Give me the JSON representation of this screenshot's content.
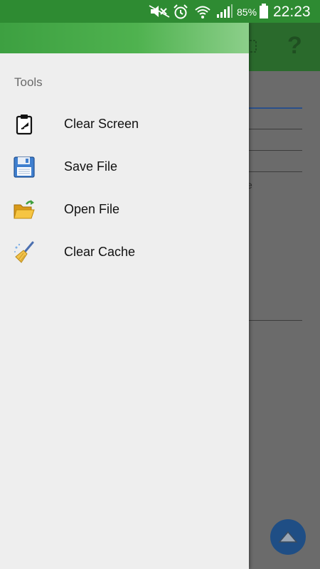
{
  "status_bar": {
    "battery_percent": "85%",
    "time": "22:23",
    "icons": [
      "mute-icon",
      "alarm-icon",
      "wifi-icon",
      "signal-icon",
      "battery-icon"
    ]
  },
  "colors": {
    "status_bar": "#2e8b32",
    "toolbar": "#2a6a2c",
    "drawer_background": "#eeeeee",
    "fab": "#1f4e85"
  },
  "toolbar": {
    "help_label": "?"
  },
  "background_content": {
    "partial_text": "e"
  },
  "drawer": {
    "section_title": "Tools",
    "items": [
      {
        "label": "Clear Screen",
        "icon": "clipboard-icon"
      },
      {
        "label": "Save File",
        "icon": "floppy-disk-icon"
      },
      {
        "label": "Open File",
        "icon": "open-folder-icon"
      },
      {
        "label": "Clear Cache",
        "icon": "broom-icon"
      }
    ]
  },
  "fab": {
    "icon": "chevron-up-icon"
  }
}
